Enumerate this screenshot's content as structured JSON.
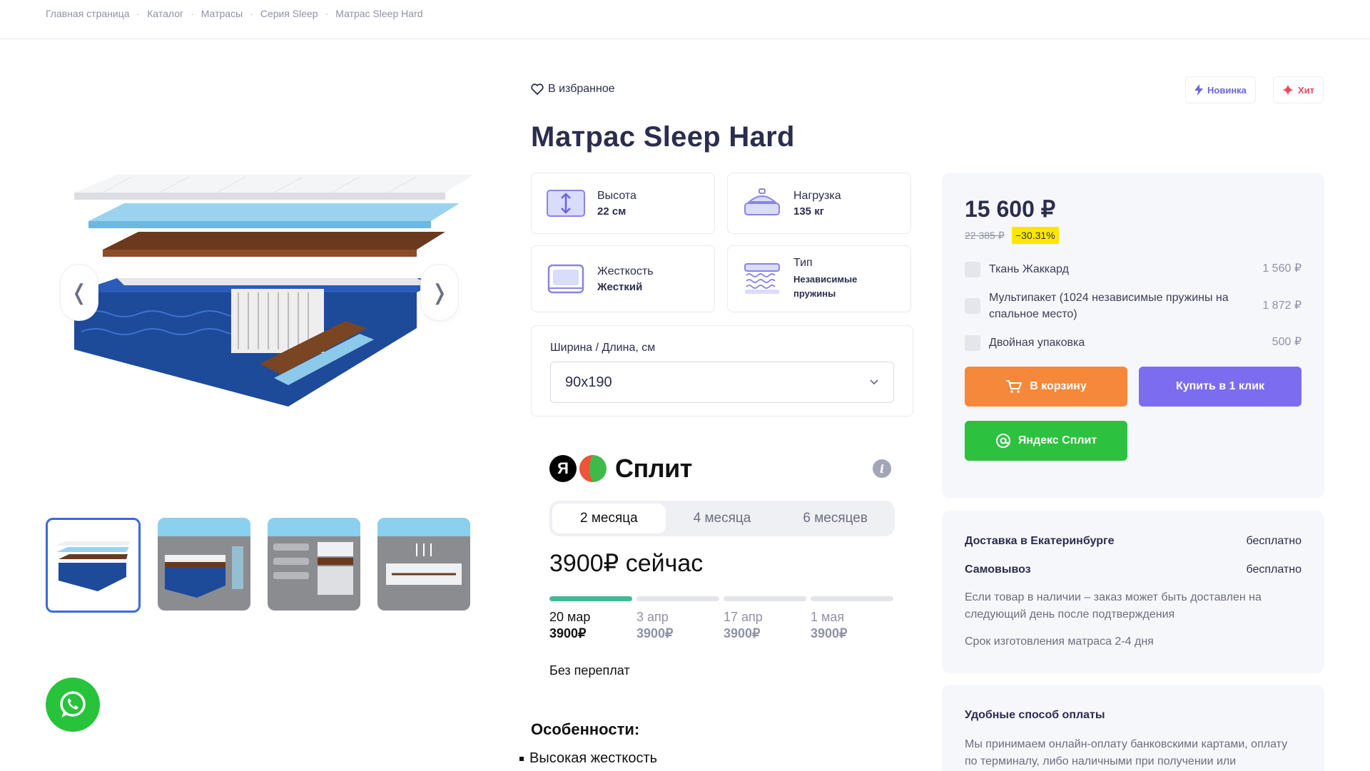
{
  "breadcrumb": [
    "Главная страница",
    "Каталог",
    "Матрасы",
    "Серия Sleep",
    "Матрас Sleep Hard"
  ],
  "breadcrumb_separator": "·",
  "gallery": {
    "prev_icon": "chevron-left-icon",
    "next_icon": "chevron-right-icon",
    "next_glyph": "❭",
    "prev_glyph": "❬",
    "thumbnail_count": 4,
    "active_thumbnail": 1
  },
  "favorite_label": "В избранное",
  "badges": {
    "new": {
      "label": "Новинка",
      "color": "#6c63e0"
    },
    "hit": {
      "label": "Хит",
      "color": "#e84a5f"
    }
  },
  "product_title": "Матрас Sleep Hard",
  "specs": [
    {
      "label": "Высота",
      "value": "22 см",
      "icon": "height-icon"
    },
    {
      "label": "Нагрузка",
      "value": "135 кг",
      "icon": "weight-icon"
    },
    {
      "label": "Жесткость",
      "value": "Жесткий",
      "icon": "firmness-icon"
    },
    {
      "label": "Тип",
      "value": "Независимые пружины",
      "icon": "springs-icon"
    }
  ],
  "size": {
    "label": "Ширина / Длина, см",
    "selected": "90x190"
  },
  "split": {
    "logo_letter": "Я",
    "logo_word": "Сплит",
    "info_glyph": "i",
    "tabs": [
      "2 месяца",
      "4 месяца",
      "6 месяцев"
    ],
    "active_tab": 0,
    "pay_now": "3900₽ сейчас",
    "schedule": [
      {
        "date": "20 мар",
        "amount": "3900₽",
        "paid": true
      },
      {
        "date": "3 апр",
        "amount": "3900₽",
        "paid": false
      },
      {
        "date": "17 апр",
        "amount": "3900₽",
        "paid": false
      },
      {
        "date": "1 мая",
        "amount": "3900₽",
        "paid": false
      }
    ],
    "no_overpay": "Без переплат"
  },
  "features": {
    "title": "Особенности:",
    "items": [
      "Высокая жесткость"
    ]
  },
  "price": {
    "current": "15 600 ₽",
    "old": "22 385 ₽",
    "discount": "−30.31%",
    "discount_color": "#ffe600"
  },
  "options": [
    {
      "name": "Ткань Жаккард",
      "cost": "1 560 ₽",
      "checked": false
    },
    {
      "name": "Мультипакет (1024 независимые пружины на спальное место)",
      "cost": "1 872 ₽",
      "checked": false
    },
    {
      "name": "Двойная упаковка",
      "cost": "500 ₽",
      "checked": false
    }
  ],
  "buttons": {
    "cart": "В корзину",
    "one_click": "Купить в 1 клик",
    "split": "Яндекс Сплит"
  },
  "colors": {
    "cart": "#f5883a",
    "one_click": "#7b6cf0",
    "split": "#2cc13e",
    "accent_text": "#2b2d4e"
  },
  "delivery": {
    "rows": [
      {
        "label": "Доставка в Екатеринбурге",
        "value": "бесплатно"
      },
      {
        "label": "Самовывоз",
        "value": "бесплатно"
      }
    ],
    "note1": "Если товар в наличии – заказ может быть доставлен на следующий день после подтверждения",
    "note2": "Срок изготовления матраса 2-4 дня"
  },
  "payment": {
    "title": "Удобные способ оплаты",
    "text": "Мы принимаем онлайн-оплату банковскими картами, оплату по терминалу, либо наличными при получении или"
  }
}
